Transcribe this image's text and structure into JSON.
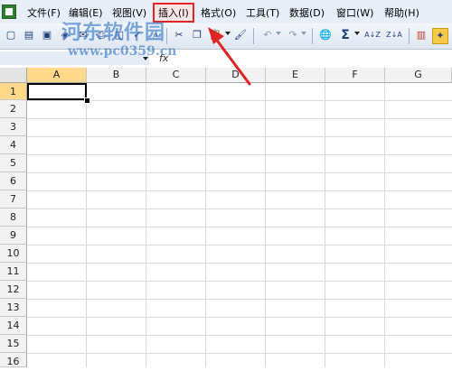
{
  "menubar": {
    "items": [
      "文件(F)",
      "编辑(E)",
      "视图(V)",
      "插入(I)",
      "格式(O)",
      "工具(T)",
      "数据(D)",
      "窗口(W)",
      "帮助(H)"
    ]
  },
  "toolbar": {
    "sigma": "Σ",
    "sort_asc": "A↓Z",
    "sort_desc": "Z↓A"
  },
  "formula": {
    "namebox": "",
    "fx": "fx"
  },
  "watermark": {
    "title": "河东软件园",
    "url": "www.pc0359.cn"
  },
  "sheet": {
    "columns": [
      "A",
      "B",
      "C",
      "D",
      "E",
      "F",
      "G"
    ],
    "rows": [
      "1",
      "2",
      "3",
      "4",
      "5",
      "6",
      "7",
      "8",
      "9",
      "10",
      "11",
      "12",
      "13",
      "14",
      "15",
      "16"
    ],
    "active_cell": "A1"
  },
  "colors": {
    "highlight_box": "#e02424",
    "arrow": "#e02424",
    "active_header": "#ffd88a"
  }
}
